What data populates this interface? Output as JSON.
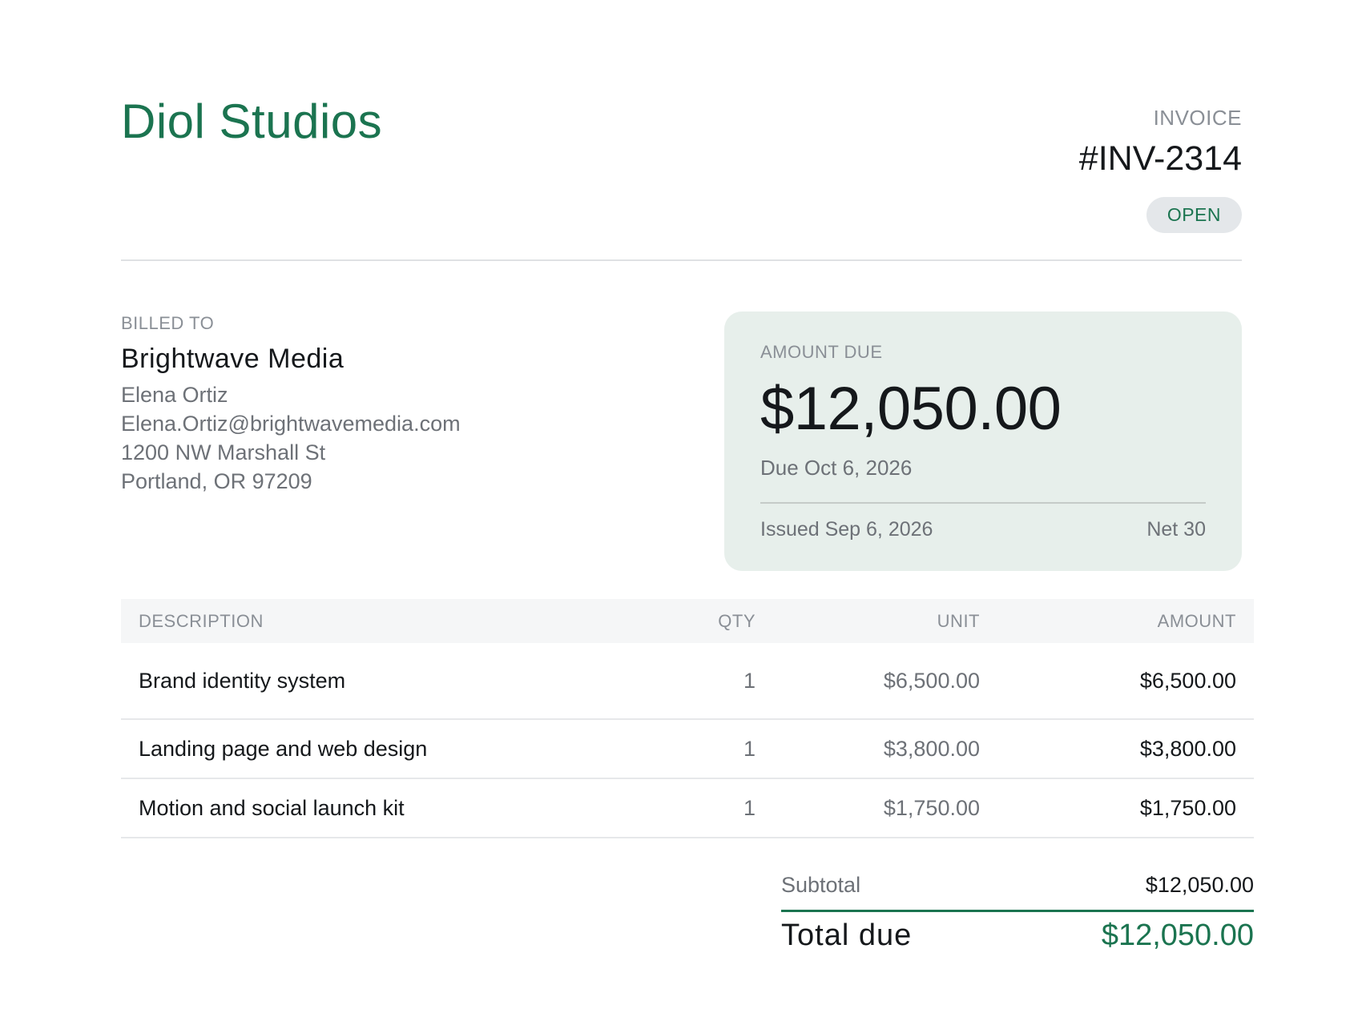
{
  "vendor": {
    "name": "Diol Studios"
  },
  "invoice": {
    "kicker": "INVOICE",
    "number": "#INV-2314",
    "status": "OPEN"
  },
  "billed_to": {
    "kicker": "BILLED TO",
    "company": "Brightwave Media",
    "contact": "Elena Ortiz",
    "email": "Elena.Ortiz@brightwavemedia.com",
    "street": "1200 NW Marshall St",
    "city": "Portland, OR 97209"
  },
  "amount_card": {
    "kicker": "AMOUNT DUE",
    "amount": "$12,050.00",
    "due": "Due Oct 6, 2026",
    "issued": "Issued Sep 6, 2026",
    "terms": "Net 30"
  },
  "table": {
    "headers": {
      "description": "DESCRIPTION",
      "qty": "QTY",
      "unit": "UNIT",
      "amount": "AMOUNT"
    },
    "rows": [
      {
        "description": "Brand identity system",
        "qty": "1",
        "unit": "$6,500.00",
        "amount": "$6,500.00"
      },
      {
        "description": "Landing page and web design",
        "qty": "1",
        "unit": "$3,800.00",
        "amount": "$3,800.00"
      },
      {
        "description": "Motion and social launch kit",
        "qty": "1",
        "unit": "$1,750.00",
        "amount": "$1,750.00"
      }
    ]
  },
  "totals": {
    "subtotal_label": "Subtotal",
    "subtotal_value": "$12,050.00",
    "total_label": "Total due",
    "total_value": "$12,050.00"
  },
  "colors": {
    "brand": "#1b7450",
    "card_background": "#e7efeb",
    "badge_background": "#e4e7ea",
    "muted_text": "#6d7177"
  }
}
